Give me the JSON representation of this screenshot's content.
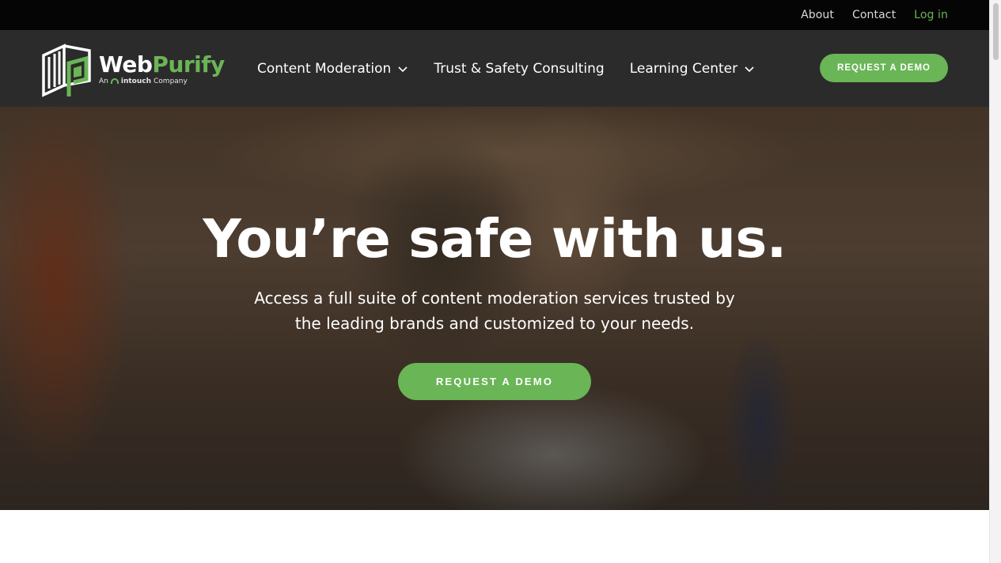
{
  "topbar": {
    "links": [
      {
        "label": "About"
      },
      {
        "label": "Contact"
      },
      {
        "label": "Log in"
      }
    ]
  },
  "logo": {
    "word_first": "Web",
    "word_second": "Purify",
    "tag_prefix": "An",
    "tag_brand": "intouch",
    "tag_suffix": "Company",
    "icon": "webpurify-logo-icon"
  },
  "nav": {
    "items": [
      {
        "label": "Content Moderation",
        "has_dropdown": true
      },
      {
        "label": "Trust & Safety Consulting",
        "has_dropdown": false
      },
      {
        "label": "Learning Center",
        "has_dropdown": true
      }
    ],
    "cta_label": "REQUEST A DEMO"
  },
  "hero": {
    "title": "You’re safe with us.",
    "subtitle_line1": "Access a full suite of content moderation services trusted by",
    "subtitle_line2": "the leading brands and customized to your needs.",
    "cta_label": "REQUEST A DEMO"
  },
  "colors": {
    "accent": "#6ab556",
    "topbar": "#050505",
    "navbar": "#2b2b2b"
  }
}
